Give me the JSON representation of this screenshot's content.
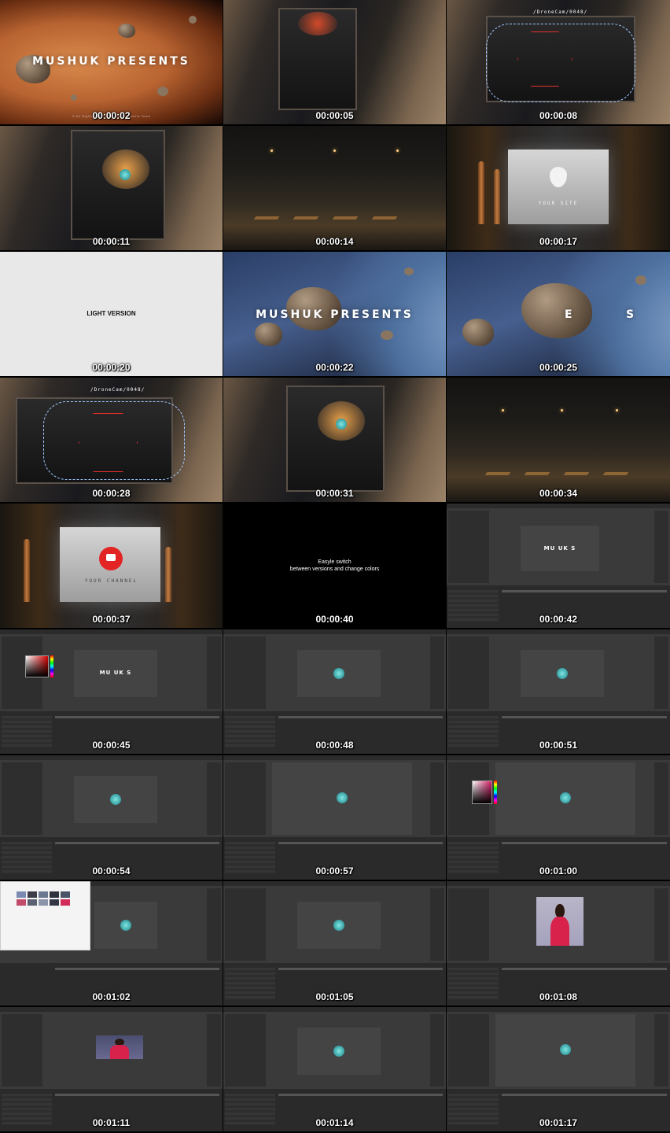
{
  "frames": [
    {
      "time": "00:00:02",
      "title": "MUSHUK PRESENTS",
      "copyright": "© All Rights Reserved | Mushuk Media Team"
    },
    {
      "time": "00:00:05"
    },
    {
      "time": "00:00:08",
      "hud": "/DroneCam/0048/"
    },
    {
      "time": "00:00:11"
    },
    {
      "time": "00:00:14"
    },
    {
      "time": "00:00:17",
      "board_text": "YOUR SITE"
    },
    {
      "time": "00:00:20",
      "caption": "LIGHT VERSION"
    },
    {
      "time": "00:00:22",
      "title": "MUSHUK PRESENTS"
    },
    {
      "time": "00:00:25",
      "title_left": "E",
      "title_right": "S"
    },
    {
      "time": "00:00:28",
      "hud": "/DroneCam/0048/"
    },
    {
      "time": "00:00:31"
    },
    {
      "time": "00:00:34"
    },
    {
      "time": "00:00:37",
      "board_text": "YOUR CHANNEL"
    },
    {
      "time": "00:00:40",
      "caption_line1": "Easyle switch",
      "caption_line2": "between versions and change colors"
    },
    {
      "time": "00:00:42",
      "viewer_text": "MU   UK   S"
    },
    {
      "time": "00:00:45",
      "viewer_text": "MU   UK   S"
    },
    {
      "time": "00:00:48"
    },
    {
      "time": "00:00:51"
    },
    {
      "time": "00:00:54"
    },
    {
      "time": "00:00:57"
    },
    {
      "time": "00:01:00"
    },
    {
      "time": "00:01:02"
    },
    {
      "time": "00:01:05"
    },
    {
      "time": "00:01:08"
    },
    {
      "time": "00:01:11"
    },
    {
      "time": "00:01:14"
    },
    {
      "time": "00:01:17"
    }
  ],
  "colors": {
    "accent_red": "#e5302a",
    "hud_blue": "#9ec7ff",
    "ae_panel": "#3a3a3a"
  }
}
